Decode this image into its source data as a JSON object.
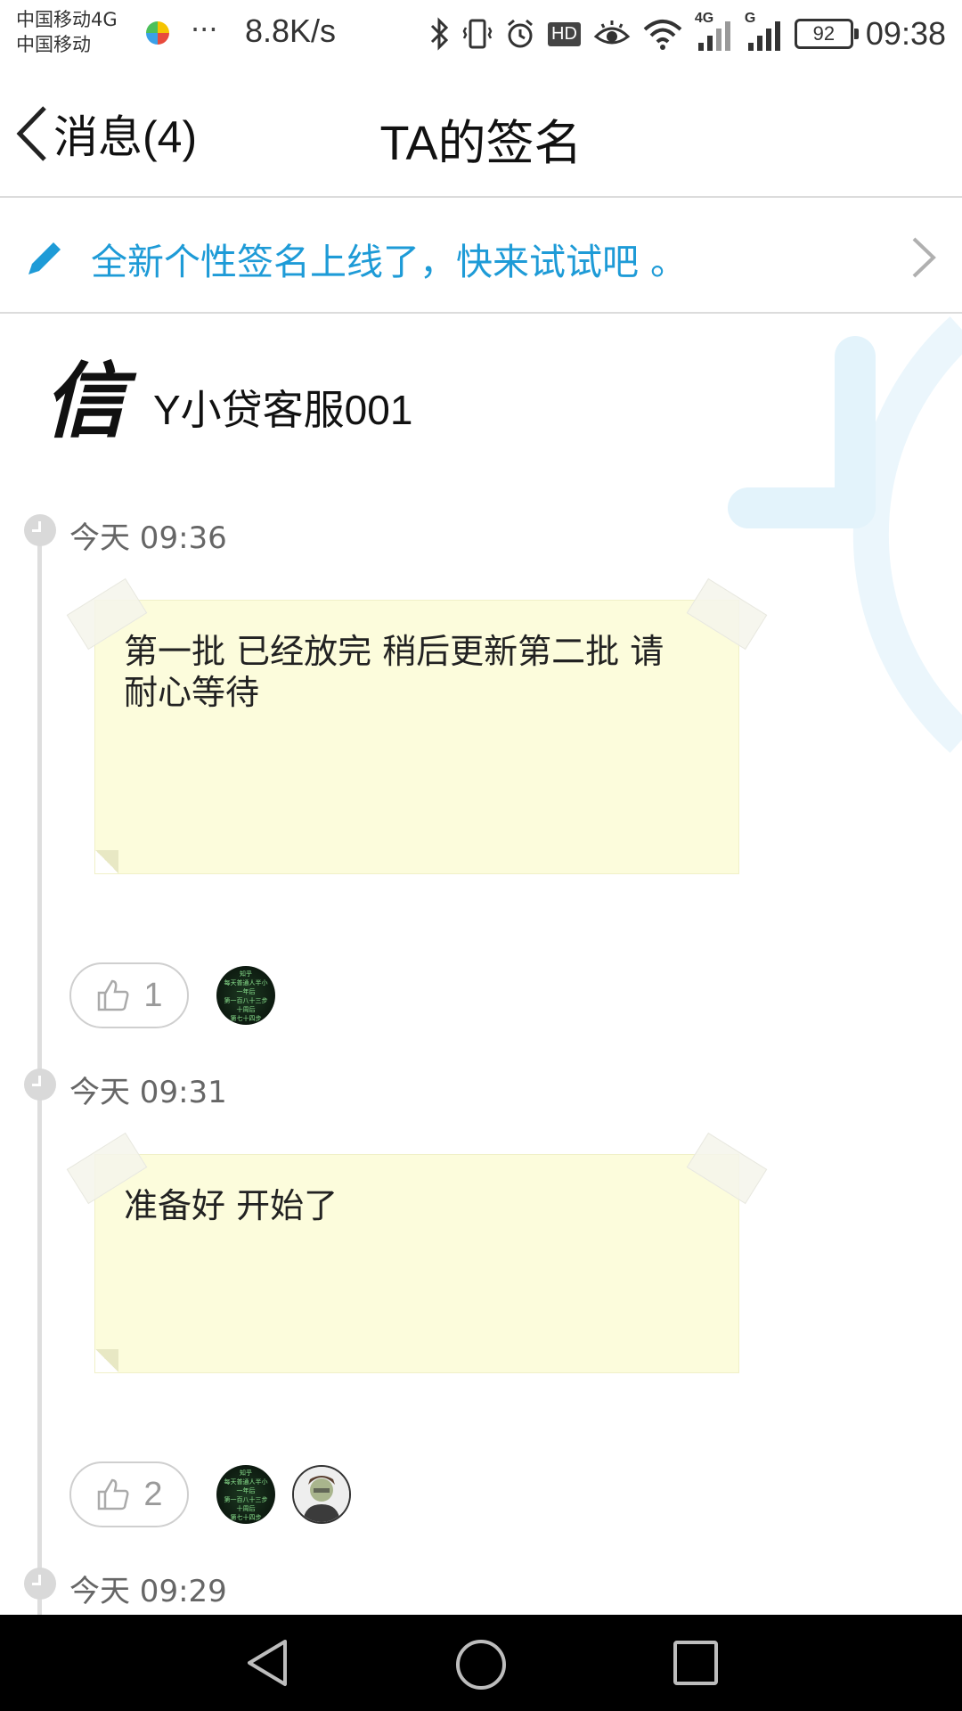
{
  "status_bar": {
    "carrier_1": "中国移动4G",
    "carrier_2": "中国移动",
    "more": "···",
    "net_speed": "8.8K/s",
    "icons": [
      "bluetooth-icon",
      "vibrate-icon",
      "alarm-icon",
      "hd-icon",
      "eye-icon",
      "wifi-icon",
      "signal-4g-icon",
      "signal-g-icon",
      "battery-icon"
    ],
    "hd_label": "HD",
    "signal_4g_label": "4G",
    "signal_g_label": "G",
    "battery": "92",
    "time": "09:38"
  },
  "nav": {
    "back_label": "消息(4)",
    "title": "TA的签名"
  },
  "banner": {
    "text": "全新个性签名上线了，快来试试吧 。"
  },
  "profile": {
    "avatar_char": "信",
    "name": "Y小贷客服001"
  },
  "entries": [
    {
      "time": "今天 09:36",
      "text": "第一批 已经放完  稍后更新第二批 请耐心等待",
      "likes": "1"
    },
    {
      "time": "今天 09:31",
      "text": "准备好 开始了",
      "likes": "2"
    },
    {
      "time": "今天 09:29"
    }
  ],
  "liker_avatar_text": [
    "知乎",
    "每天普通人半小",
    "一年后",
    "第一百八十三步",
    "十周后",
    "第七十四步"
  ],
  "colors": {
    "accent": "#1e9bd7",
    "note_bg": "#fcfcdc",
    "timeline": "#dedede"
  }
}
